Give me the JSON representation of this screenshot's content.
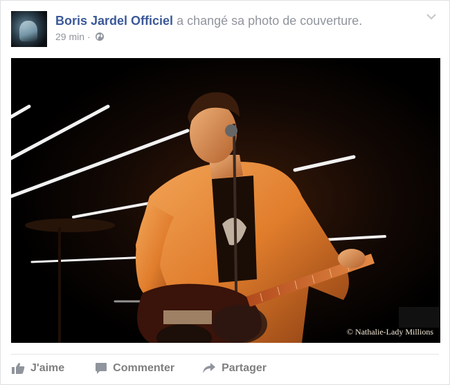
{
  "post": {
    "page_name": "Boris Jardel Officiel",
    "action_text": "a changé sa photo de couverture.",
    "time": "29 min",
    "separator": "·",
    "audience_icon": "globe-icon",
    "menu_icon": "chevron-down-icon"
  },
  "photo": {
    "watermark": "© Nathalie-Lady Millions"
  },
  "actions": [
    {
      "label": "J'aime",
      "icon": "thumbs-up-icon"
    },
    {
      "label": "Commenter",
      "icon": "comment-icon"
    },
    {
      "label": "Partager",
      "icon": "share-icon"
    }
  ],
  "colors": {
    "link": "#3b5998",
    "muted": "#90949c",
    "action": "#7f7f7f"
  }
}
